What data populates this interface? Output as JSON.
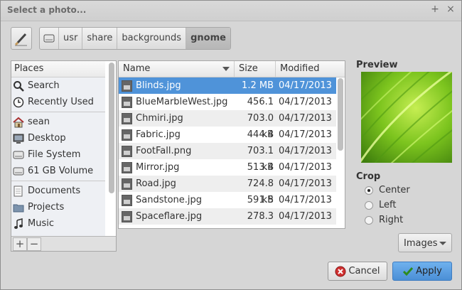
{
  "window": {
    "title": "Select a photo...",
    "pin_glyph": "+",
    "close_glyph": "×"
  },
  "toolbar": {
    "edit_icon": "pencil-icon"
  },
  "pathbar": {
    "crumbs": [
      "usr",
      "share",
      "backgrounds",
      "gnome"
    ],
    "active": "gnome"
  },
  "places": {
    "header": "Places",
    "items": [
      {
        "label": "Search",
        "icon": "search-icon"
      },
      {
        "label": "Recently Used",
        "icon": "clock-icon"
      },
      {
        "label": "sean",
        "icon": "home-icon"
      },
      {
        "label": "Desktop",
        "icon": "desktop-icon"
      },
      {
        "label": "File System",
        "icon": "drive-icon"
      },
      {
        "label": "61 GB Volume",
        "icon": "drive-icon"
      },
      {
        "label": "Documents",
        "icon": "folder-icon"
      },
      {
        "label": "Projects",
        "icon": "folder-icon"
      },
      {
        "label": "Music",
        "icon": "music-icon"
      }
    ],
    "add_label": "+",
    "remove_label": "−"
  },
  "files": {
    "columns": {
      "name": "Name",
      "size": "Size",
      "modified": "Modified"
    },
    "rows": [
      {
        "name": "Blinds.jpg",
        "size": "1.2 MB",
        "modified": "04/17/2013"
      },
      {
        "name": "BlueMarbleWest.jpg",
        "size": "456.1 kB",
        "modified": "04/17/2013"
      },
      {
        "name": "Chmiri.jpg",
        "size": "703.0 kB",
        "modified": "04/17/2013"
      },
      {
        "name": "Fabric.jpg",
        "size": "444.4 kB",
        "modified": "04/17/2013"
      },
      {
        "name": "FootFall.png",
        "size": "703.1 kB",
        "modified": "04/17/2013"
      },
      {
        "name": "Mirror.jpg",
        "size": "513.4 kB",
        "modified": "04/17/2013"
      },
      {
        "name": "Road.jpg",
        "size": "724.8 kB",
        "modified": "04/17/2013"
      },
      {
        "name": "Sandstone.jpg",
        "size": "591.5 kB",
        "modified": "04/17/2013"
      },
      {
        "name": "Spaceflare.jpg",
        "size": "278.3 kB",
        "modified": "04/17/2013"
      }
    ],
    "selected": "Blinds.jpg"
  },
  "preview": {
    "label": "Preview"
  },
  "crop": {
    "label": "Crop",
    "options": [
      "Center",
      "Left",
      "Right"
    ],
    "selected": "Center"
  },
  "filter": {
    "label": "Images"
  },
  "buttons": {
    "cancel": "Cancel",
    "apply": "Apply"
  },
  "colors": {
    "selection": "#4f93d9",
    "apply": "#5c9fe2",
    "leaf": "#7cc41e"
  }
}
